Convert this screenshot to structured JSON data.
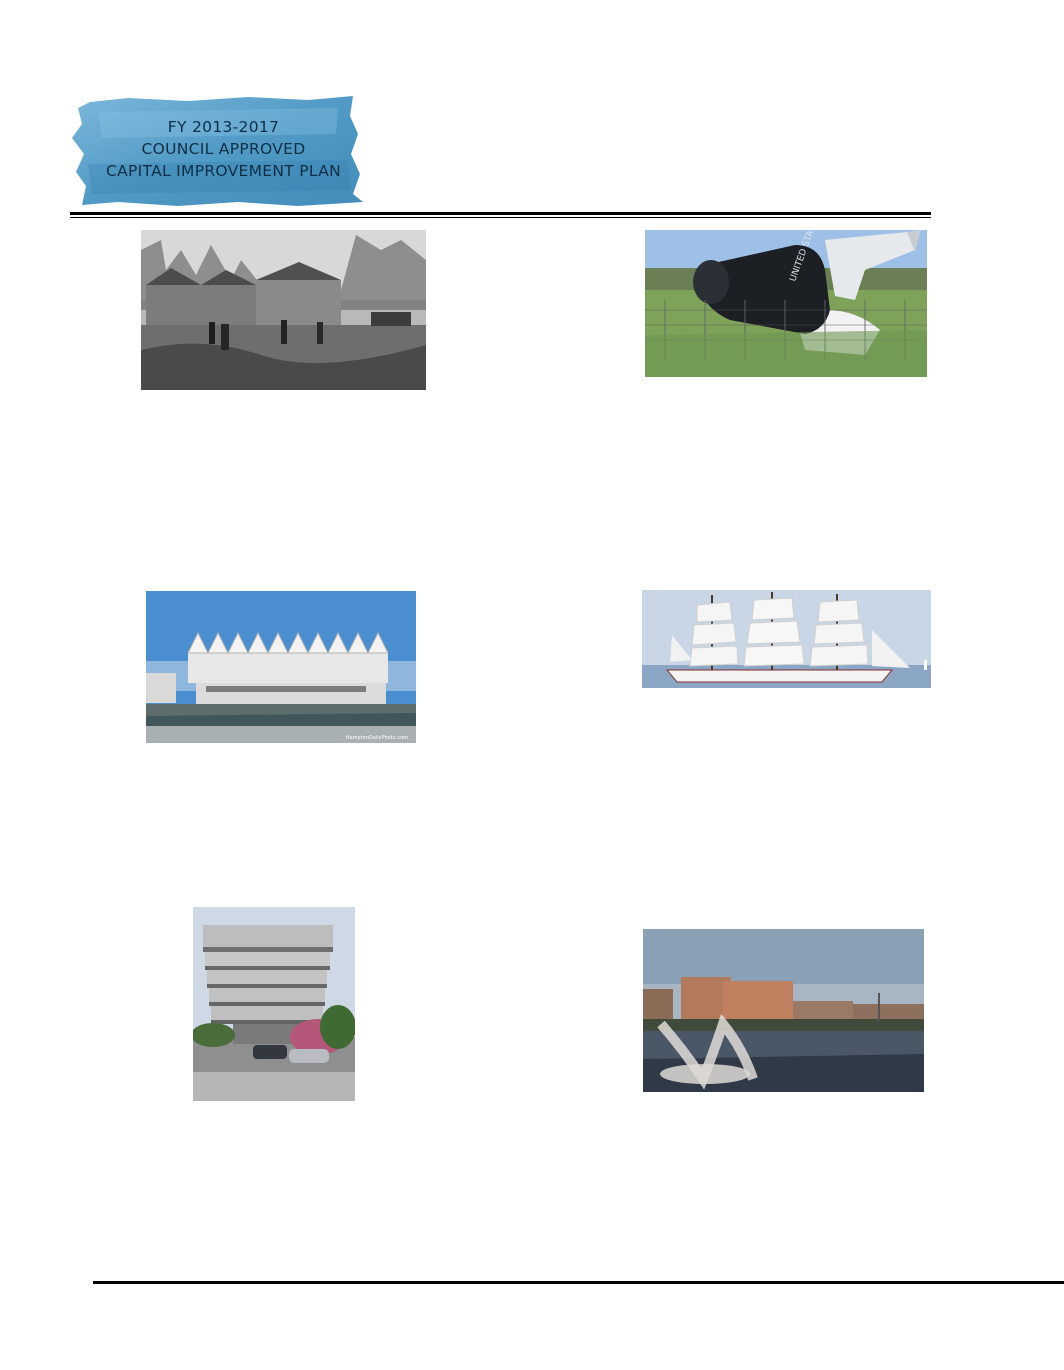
{
  "banner": {
    "line1": "FY 2013-2017",
    "line2": "COUNCIL APPROVED",
    "line3": "CAPITAL IMPROVEMENT PLAN",
    "color": "#3d8fbf"
  },
  "photos": {
    "historic_construction": {
      "icon": "historic-construction-photo"
    },
    "bottle_monument": {
      "icon": "bottle-monument-photo",
      "label": "UNITED STATES"
    },
    "coliseum": {
      "icon": "coliseum-photo",
      "watermark": "HamptonDailyPhoto.com"
    },
    "tall_ship": {
      "icon": "tall-ship-photo"
    },
    "office_tower": {
      "icon": "office-tower-photo"
    },
    "hospital_fountain": {
      "icon": "hospital-fountain-photo"
    }
  }
}
